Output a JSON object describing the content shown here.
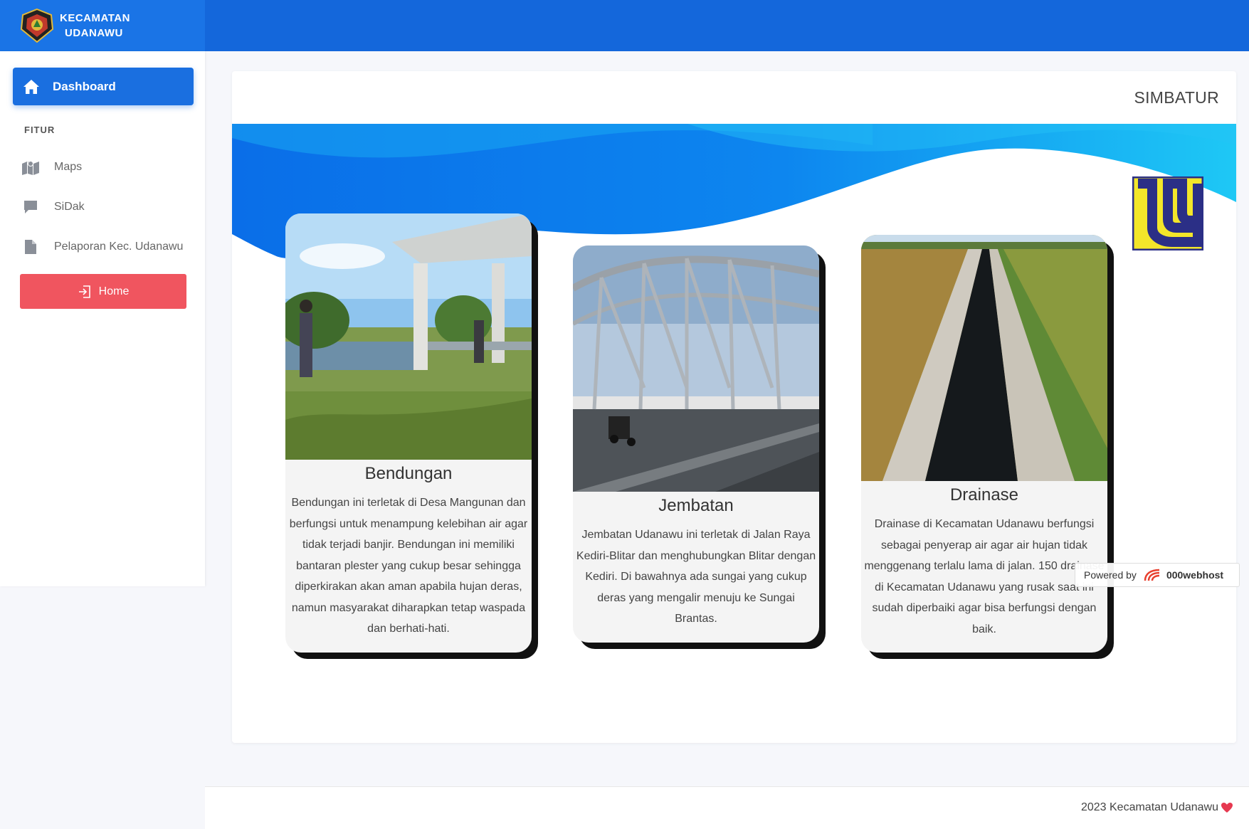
{
  "brand": {
    "line1": "KECAMATAN",
    "line2": "UDANAWU"
  },
  "sidebar": {
    "dashboard_label": "Dashboard",
    "section_label": "FITUR",
    "items": [
      {
        "label": "Maps",
        "icon": "map-icon"
      },
      {
        "label": "SiDak",
        "icon": "chat-icon"
      },
      {
        "label": "Pelaporan Kec. Udanawu",
        "icon": "file-icon"
      }
    ],
    "home_button_label": "Home"
  },
  "page": {
    "title": "SIMBATUR"
  },
  "cards": [
    {
      "title": "Bendungan",
      "description": "Bendungan ini terletak di Desa Mangunan dan berfungsi untuk menampung kelebihan air agar tidak terjadi banjir. Bendungan ini memiliki bantaran plester yang cukup besar sehingga diperkirakan akan aman apabila hujan deras, namun masyarakat diharapkan tetap waspada dan berhati-hati."
    },
    {
      "title": "Jembatan",
      "description": "Jembatan Udanawu ini terletak di Jalan Raya Kediri-Blitar dan menghubungkan Blitar dengan Kediri. Di bawahnya ada sungai yang cukup deras yang mengalir menuju ke Sungai Brantas."
    },
    {
      "title": "Drainase",
      "description": "Drainase di Kecamatan Udanawu berfungsi sebagai penyerap air agar air hujan tidak menggenang terlalu lama di jalan. 150 drainase di Kecamatan Udanawu yang rusak saat ini sudah diperbaiki agar bisa berfungsi dengan baik."
    }
  ],
  "footer": {
    "text": "2023 Kecamatan Udanawu"
  },
  "badge": {
    "powered_by": "Powered by",
    "brand": "000webhost"
  },
  "colors": {
    "primary": "#1a6fe0",
    "topbar": "#1467db",
    "danger": "#f0555f",
    "wave_light": "#1ec8f5",
    "wave_dark": "#0a6ee8"
  }
}
